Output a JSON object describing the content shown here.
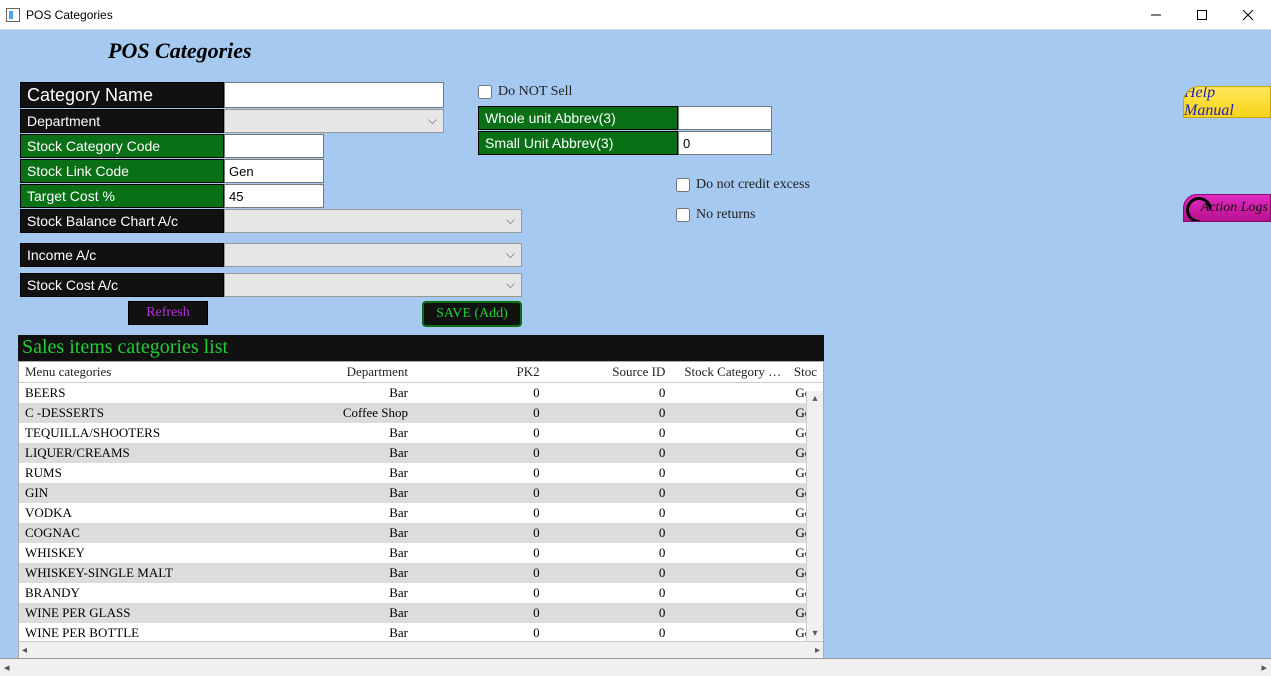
{
  "window": {
    "title": "POS Categories"
  },
  "page": {
    "title": "POS Categories"
  },
  "form": {
    "categoryName": {
      "label": "Category Name",
      "value": ""
    },
    "department": {
      "label": "Department",
      "value": ""
    },
    "stockCategoryCode": {
      "label": "Stock Category Code",
      "value": ""
    },
    "stockLinkCode": {
      "label": "Stock Link Code",
      "value": "Gen"
    },
    "targetCostPct": {
      "label": "Target Cost %",
      "value": "45"
    },
    "stockBalanceChartAc": {
      "label": "Stock Balance Chart A/c",
      "value": ""
    },
    "incomeAc": {
      "label": "Income A/c",
      "value": ""
    },
    "stockCostAc": {
      "label": "Stock Cost A/c",
      "value": ""
    }
  },
  "right": {
    "doNotSell": {
      "label": "Do NOT Sell",
      "checked": false
    },
    "wholeUnitAbbrev": {
      "label": "Whole unit Abbrev(3)",
      "value": ""
    },
    "smallUnitAbbrev": {
      "label": "Small Unit Abbrev(3)",
      "value": "0"
    },
    "doNotCreditExcess": {
      "label": "Do not credit excess",
      "checked": false
    },
    "noReturns": {
      "label": "No returns",
      "checked": false
    }
  },
  "buttons": {
    "refresh": "Refresh",
    "save": "SAVE (Add)"
  },
  "sideTabs": {
    "help": "Help Manual",
    "logs": "Action Logs"
  },
  "grid": {
    "title": "Sales items categories list",
    "headers": [
      "Menu categories",
      "Department",
      "PK2",
      "Source ID",
      "Stock Category …",
      "Stoc"
    ],
    "rows": [
      {
        "menu": "BEERS",
        "dept": "Bar",
        "pk2": "0",
        "src": "0",
        "scat": "",
        "stoc": "Gen"
      },
      {
        "menu": "C -DESSERTS",
        "dept": "Coffee Shop",
        "pk2": "0",
        "src": "0",
        "scat": "",
        "stoc": "Gen"
      },
      {
        "menu": "TEQUILLA/SHOOTERS",
        "dept": "Bar",
        "pk2": "0",
        "src": "0",
        "scat": "",
        "stoc": "Gen"
      },
      {
        "menu": "LIQUER/CREAMS",
        "dept": "Bar",
        "pk2": "0",
        "src": "0",
        "scat": "",
        "stoc": "Gen"
      },
      {
        "menu": "RUMS",
        "dept": "Bar",
        "pk2": "0",
        "src": "0",
        "scat": "",
        "stoc": "Gen"
      },
      {
        "menu": "GIN",
        "dept": "Bar",
        "pk2": "0",
        "src": "0",
        "scat": "",
        "stoc": "Gen"
      },
      {
        "menu": "VODKA",
        "dept": "Bar",
        "pk2": "0",
        "src": "0",
        "scat": "",
        "stoc": "Gen"
      },
      {
        "menu": "COGNAC",
        "dept": "Bar",
        "pk2": "0",
        "src": "0",
        "scat": "",
        "stoc": "Gen"
      },
      {
        "menu": "WHISKEY",
        "dept": "Bar",
        "pk2": "0",
        "src": "0",
        "scat": "",
        "stoc": "Gen"
      },
      {
        "menu": "WHISKEY-SINGLE MALT",
        "dept": "Bar",
        "pk2": "0",
        "src": "0",
        "scat": "",
        "stoc": "Gen"
      },
      {
        "menu": "BRANDY",
        "dept": "Bar",
        "pk2": "0",
        "src": "0",
        "scat": "",
        "stoc": "Gen"
      },
      {
        "menu": "WINE PER GLASS",
        "dept": "Bar",
        "pk2": "0",
        "src": "0",
        "scat": "",
        "stoc": "Gen"
      },
      {
        "menu": "WINE PER BOTTLE",
        "dept": "Bar",
        "pk2": "0",
        "src": "0",
        "scat": "",
        "stoc": "Gen"
      }
    ]
  }
}
